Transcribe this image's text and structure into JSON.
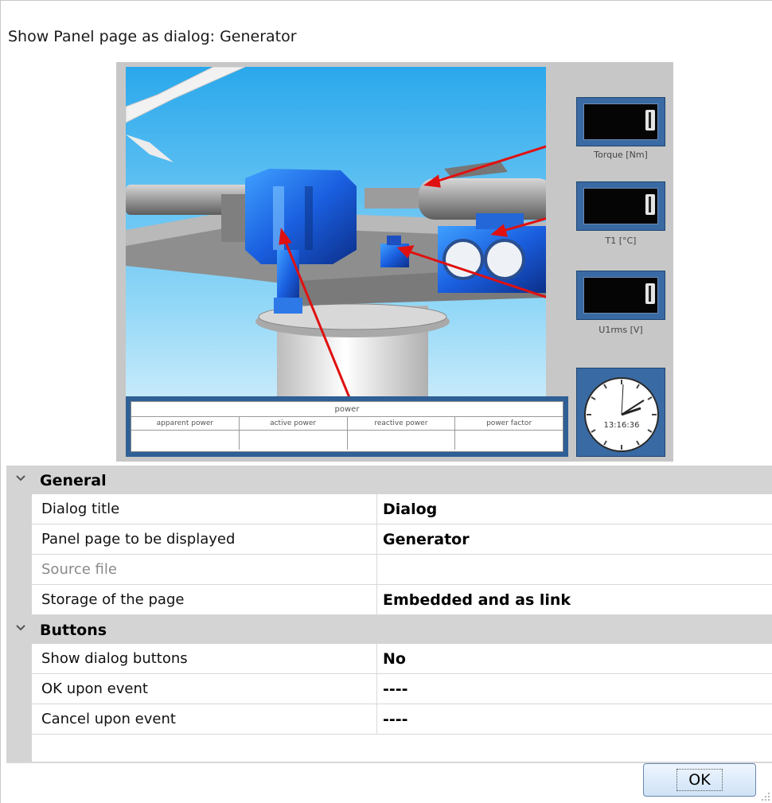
{
  "dialog": {
    "title": "Show Panel page as dialog: Generator"
  },
  "preview": {
    "table": {
      "header": "power",
      "columns": [
        "apparent power",
        "active power",
        "reactive power",
        "power factor"
      ]
    },
    "gauges": [
      {
        "label": "Torque [Nm]"
      },
      {
        "label": "T1 [°C]"
      },
      {
        "label": "U1rms [V]"
      }
    ],
    "clock": {
      "time": "13:16:36"
    }
  },
  "property_grid": {
    "general": {
      "label": "General",
      "rows": [
        {
          "name": "Dialog title",
          "value": "Dialog"
        },
        {
          "name": "Panel page to be displayed",
          "value": "Generator"
        },
        {
          "name": "Source file",
          "value": ""
        },
        {
          "name": "Storage of the page",
          "value": "Embedded and as link"
        }
      ]
    },
    "buttons": {
      "label": "Buttons",
      "rows": [
        {
          "name": "Show dialog buttons",
          "value": "No"
        },
        {
          "name": "OK upon event",
          "value": "----"
        },
        {
          "name": "Cancel upon event",
          "value": "----"
        }
      ]
    }
  },
  "footer": {
    "ok_label": "OK"
  },
  "colors": {
    "panel_blue": "#3a6aa3",
    "sky": "#5cc0f0",
    "category_bg": "#d4d4d4",
    "arrow": "#e01010"
  }
}
